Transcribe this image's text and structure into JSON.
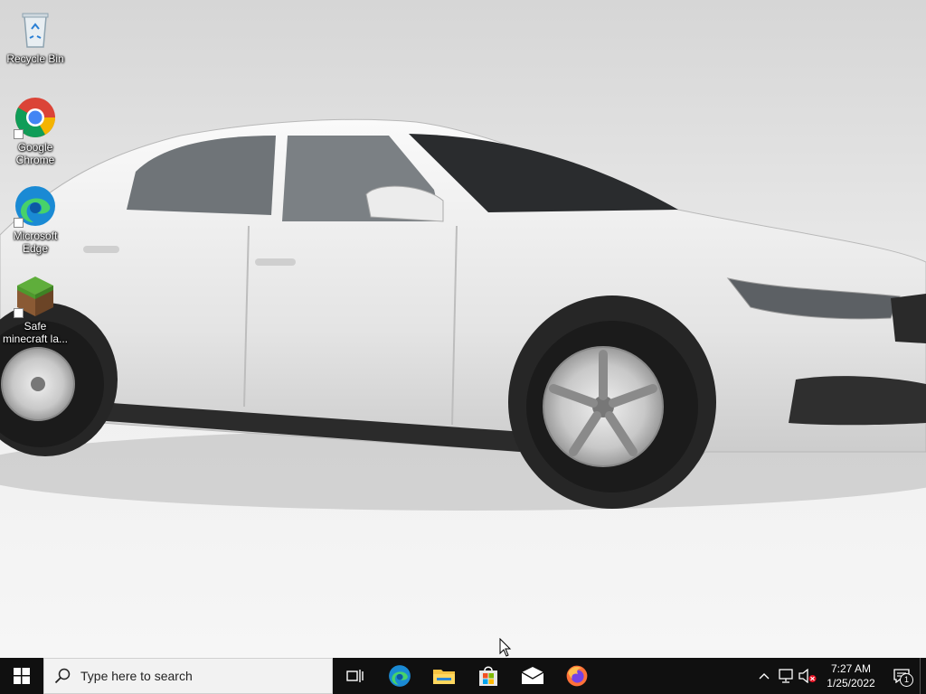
{
  "desktop": {
    "wallpaper": "white-sedan-car",
    "icons": [
      {
        "label": "Recycle Bin",
        "icon": "recycle-bin-icon"
      },
      {
        "label": "Google Chrome",
        "icon": "chrome-icon"
      },
      {
        "label": "Microsoft Edge",
        "icon": "edge-icon"
      },
      {
        "label": "Safe minecraft la...",
        "icon": "minecraft-grass-block-icon"
      }
    ]
  },
  "taskbar": {
    "search_placeholder": "Type here to search",
    "pinned": [
      "task-view-icon",
      "edge-icon",
      "file-explorer-icon",
      "microsoft-store-icon",
      "mail-icon",
      "firefox-icon"
    ],
    "clock": {
      "time": "7:27 AM",
      "date": "1/25/2022"
    },
    "notification_count": "1"
  },
  "colors": {
    "taskbar": "#101010",
    "accent": "#0078d7"
  }
}
